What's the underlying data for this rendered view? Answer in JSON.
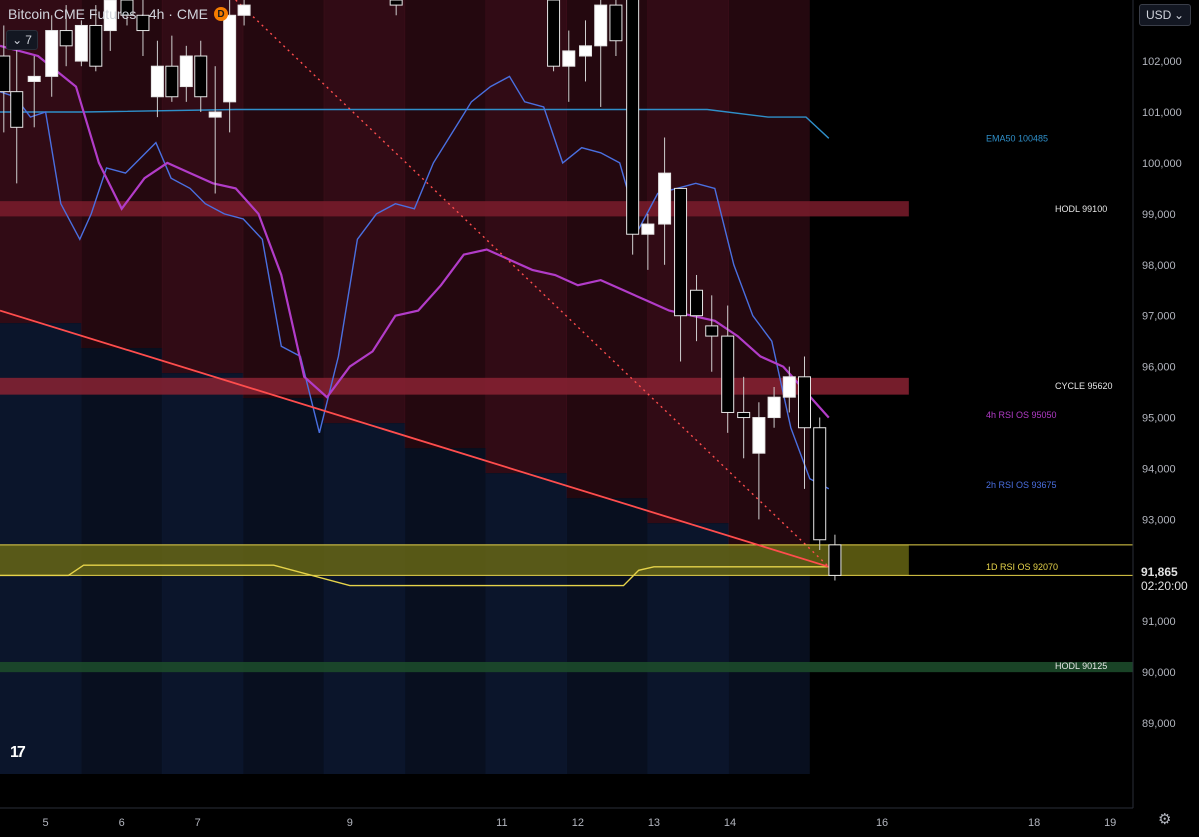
{
  "header": {
    "title": "Bitcoin CME Futures · 4h · CME",
    "badge": "D",
    "indicator_count": "7",
    "currency": "USD"
  },
  "price_tag": {
    "last": "91,865",
    "countdown": "02:20:00"
  },
  "colors": {
    "background": "#000000",
    "band_red": "#5a1426",
    "band_blue": "#0c1730",
    "candle_up": "#ffffff",
    "candle_down": "#000000",
    "ema50": "#2f8fc9",
    "rsi_2h": "#4a6fe0",
    "rsi_4h": "#b23cc8",
    "rsi_1d": "#e6d34a",
    "trendline": "#ff4d4d",
    "hodl_top": "#7a1c2c",
    "cycle": "#8a2233",
    "yellow_zone": "#6b6a14",
    "hodl_green": "#1c4a2a"
  },
  "chart_data": {
    "type": "candlestick",
    "title": "Bitcoin CME Futures · 4h · CME",
    "ylim": [
      88000,
      103200
    ],
    "xlim": [
      4.4,
      19.3
    ],
    "y_ticks": [
      89000,
      90000,
      91000,
      92000,
      93000,
      94000,
      95000,
      96000,
      97000,
      98000,
      99000,
      100000,
      101000,
      102000
    ],
    "y_tick_labels": [
      "89,000",
      "90,000",
      "91,000",
      "92,000",
      "93,000",
      "94,000",
      "95,000",
      "96,000",
      "97,000",
      "98,000",
      "99,000",
      "100,000",
      "101,000",
      "102,000"
    ],
    "x_ticks": [
      5,
      6,
      7,
      9,
      11,
      12,
      13,
      14,
      16,
      18,
      19
    ],
    "x_tick_labels": [
      "5",
      "6",
      "7",
      "9",
      "11",
      "12",
      "13",
      "14",
      "16",
      "18",
      "19"
    ],
    "candles": [
      {
        "x": 4.45,
        "o": 102100,
        "h": 102700,
        "l": 100600,
        "c": 101400
      },
      {
        "x": 4.62,
        "o": 101400,
        "h": 102600,
        "l": 99600,
        "c": 100700
      },
      {
        "x": 4.85,
        "o": 101600,
        "h": 102100,
        "l": 100700,
        "c": 101700
      },
      {
        "x": 5.08,
        "o": 101700,
        "h": 102900,
        "l": 101300,
        "c": 102600
      },
      {
        "x": 5.27,
        "o": 102600,
        "h": 103100,
        "l": 101900,
        "c": 102300
      },
      {
        "x": 5.47,
        "o": 102000,
        "h": 102800,
        "l": 101900,
        "c": 102700
      },
      {
        "x": 5.66,
        "o": 102700,
        "h": 103100,
        "l": 101800,
        "c": 101900
      },
      {
        "x": 5.85,
        "o": 102600,
        "h": 103400,
        "l": 102200,
        "c": 103200
      },
      {
        "x": 6.07,
        "o": 103200,
        "h": 103400,
        "l": 102700,
        "c": 102900
      },
      {
        "x": 6.28,
        "o": 102900,
        "h": 103400,
        "l": 102100,
        "c": 102600
      },
      {
        "x": 6.47,
        "o": 101300,
        "h": 102400,
        "l": 100900,
        "c": 101900
      },
      {
        "x": 6.66,
        "o": 101900,
        "h": 102500,
        "l": 101200,
        "c": 101300
      },
      {
        "x": 6.85,
        "o": 101500,
        "h": 102300,
        "l": 101200,
        "c": 102100
      },
      {
        "x": 7.04,
        "o": 102100,
        "h": 102400,
        "l": 101000,
        "c": 101300
      },
      {
        "x": 7.23,
        "o": 100900,
        "h": 101900,
        "l": 99400,
        "c": 101000
      },
      {
        "x": 7.42,
        "o": 101200,
        "h": 103200,
        "l": 100600,
        "c": 102900
      },
      {
        "x": 7.61,
        "o": 102900,
        "h": 103200,
        "l": 102700,
        "c": 103100
      },
      {
        "x": 9.61,
        "o": 103200,
        "h": 103400,
        "l": 102900,
        "c": 103100
      },
      {
        "x": 11.68,
        "o": 103200,
        "h": 103400,
        "l": 101800,
        "c": 101900
      },
      {
        "x": 11.88,
        "o": 101900,
        "h": 102600,
        "l": 101200,
        "c": 102200
      },
      {
        "x": 12.1,
        "o": 102100,
        "h": 102800,
        "l": 101600,
        "c": 102300
      },
      {
        "x": 12.3,
        "o": 102300,
        "h": 103200,
        "l": 101100,
        "c": 103100
      },
      {
        "x": 12.5,
        "o": 103100,
        "h": 103400,
        "l": 102100,
        "c": 102400
      },
      {
        "x": 12.72,
        "o": 103300,
        "h": 103400,
        "l": 98200,
        "c": 98600
      },
      {
        "x": 12.92,
        "o": 98600,
        "h": 99000,
        "l": 97900,
        "c": 98800
      },
      {
        "x": 13.14,
        "o": 98800,
        "h": 100500,
        "l": 98000,
        "c": 99800
      },
      {
        "x": 13.35,
        "o": 99500,
        "h": 99500,
        "l": 96100,
        "c": 97000
      },
      {
        "x": 13.56,
        "o": 97500,
        "h": 97800,
        "l": 96500,
        "c": 97000
      },
      {
        "x": 13.76,
        "o": 96800,
        "h": 97400,
        "l": 95900,
        "c": 96600
      },
      {
        "x": 13.97,
        "o": 96600,
        "h": 97200,
        "l": 94700,
        "c": 95100
      },
      {
        "x": 14.18,
        "o": 95100,
        "h": 95800,
        "l": 94200,
        "c": 95000
      },
      {
        "x": 14.38,
        "o": 94300,
        "h": 95300,
        "l": 93000,
        "c": 95000
      },
      {
        "x": 14.58,
        "o": 95000,
        "h": 95600,
        "l": 94800,
        "c": 95400
      },
      {
        "x": 14.78,
        "o": 95400,
        "h": 96000,
        "l": 95100,
        "c": 95800
      },
      {
        "x": 14.98,
        "o": 95800,
        "h": 96200,
        "l": 93600,
        "c": 94800
      },
      {
        "x": 15.18,
        "o": 94800,
        "h": 95000,
        "l": 92400,
        "c": 92600
      },
      {
        "x": 15.38,
        "o": 92500,
        "h": 92700,
        "l": 91800,
        "c": 91900
      }
    ],
    "series": [
      {
        "name": "EMA50",
        "color": "#2f8fc9",
        "x": [
          4.4,
          5.5,
          7.5,
          12.0,
          13.7,
          14.5,
          15.0,
          15.3
        ],
        "y": [
          101000,
          101000,
          101050,
          101050,
          101050,
          100900,
          100900,
          100485
        ]
      },
      {
        "name": "2h RSI OS",
        "color": "#4a6fe0",
        "x": [
          4.4,
          4.6,
          4.8,
          5.0,
          5.2,
          5.45,
          5.6,
          5.8,
          6.05,
          6.25,
          6.45,
          6.65,
          6.9,
          7.1,
          7.35,
          7.6,
          7.85,
          8.1,
          8.35,
          8.6,
          8.85,
          9.1,
          9.35,
          9.6,
          9.85,
          10.1,
          10.35,
          10.6,
          10.85,
          11.1,
          11.3,
          11.55,
          11.8,
          12.05,
          12.3,
          12.55,
          12.8,
          13.05,
          13.3,
          13.55,
          13.8,
          14.05,
          14.3,
          14.55,
          14.8,
          15.05,
          15.3
        ],
        "y": [
          101400,
          101300,
          100900,
          101000,
          99200,
          98500,
          99000,
          99900,
          99800,
          100100,
          100400,
          99700,
          99500,
          99200,
          99000,
          98900,
          98500,
          96400,
          96200,
          94700,
          96200,
          98500,
          99000,
          99200,
          99100,
          100000,
          100600,
          101200,
          101500,
          101700,
          101200,
          101100,
          100000,
          100300,
          100200,
          100000,
          98700,
          99400,
          99500,
          99600,
          99500,
          98000,
          97000,
          96500,
          94800,
          93800,
          93600
        ]
      },
      {
        "name": "4h RSI OS",
        "color": "#b23cc8",
        "x": [
          4.4,
          4.9,
          5.4,
          5.7,
          6.0,
          6.3,
          6.6,
          6.9,
          7.2,
          7.5,
          7.8,
          8.1,
          8.4,
          8.7,
          9.0,
          9.3,
          9.6,
          9.9,
          10.2,
          10.5,
          10.8,
          11.1,
          11.4,
          11.7,
          12.0,
          12.3,
          12.6,
          12.9,
          13.2,
          13.5,
          13.8,
          14.1,
          14.4,
          14.7,
          15.0,
          15.3
        ],
        "y": [
          102300,
          102100,
          101500,
          100000,
          99100,
          99700,
          100000,
          99800,
          99600,
          99500,
          99000,
          97800,
          95800,
          95400,
          96000,
          96300,
          97000,
          97100,
          97600,
          98200,
          98300,
          98100,
          97900,
          97800,
          97600,
          97700,
          97500,
          97300,
          97100,
          97000,
          96900,
          96600,
          96200,
          96000,
          95500,
          95000
        ]
      },
      {
        "name": "1D RSI OS",
        "color": "#e6d34a",
        "x": [
          4.4,
          5.0,
          5.3,
          5.5,
          6.5,
          7.0,
          8.0,
          9.0,
          10.0,
          11.0,
          12.0,
          12.6,
          12.8,
          13.0,
          14.0,
          15.0,
          15.3
        ],
        "y": [
          91900,
          91900,
          91900,
          92100,
          92100,
          92100,
          92100,
          91700,
          91700,
          91700,
          91700,
          91700,
          92000,
          92070,
          92070,
          92070,
          92070
        ]
      },
      {
        "name": "Trendline",
        "color": "#ff4d4d",
        "x": [
          4.4,
          15.3
        ],
        "y": [
          97100,
          92070
        ]
      },
      {
        "name": "Trendline dotted",
        "color": "#ff4d4d",
        "x": [
          7.5,
          15.3
        ],
        "y": [
          103200,
          92070
        ]
      }
    ],
    "levels": [
      {
        "name": "HODL 99100",
        "y": 99100,
        "color": "#7a1c2c"
      },
      {
        "name": "CYCLE 95620",
        "y": 95620,
        "color": "#8a2233"
      },
      {
        "name": "1D RSI OS 92070",
        "y": 92070,
        "color": "#e6d34a"
      },
      {
        "name": "HODL 90125",
        "y": 90125,
        "color": "#1c4a2a"
      }
    ],
    "zone": {
      "name": "yellow zone",
      "ymin": 91900,
      "ymax": 92500,
      "color": "#6b6a14"
    },
    "labels": [
      {
        "text": "EMA50 100485",
        "y": 100485,
        "color": "#2f8fc9"
      },
      {
        "text": "HODL 99100",
        "y": 99100,
        "color": "#e6e6e6"
      },
      {
        "text": "CYCLE 95620",
        "y": 95620,
        "color": "#e6e6e6"
      },
      {
        "text": "4h RSI OS 95050",
        "y": 95050,
        "color": "#b23cc8"
      },
      {
        "text": "2h RSI OS 93675",
        "y": 93675,
        "color": "#4a6fe0"
      },
      {
        "text": "1D RSI OS 92070",
        "y": 92070,
        "color": "#e6d34a"
      },
      {
        "text": "HODL 90125",
        "y": 90125,
        "color": "#e6e6e6"
      }
    ]
  }
}
